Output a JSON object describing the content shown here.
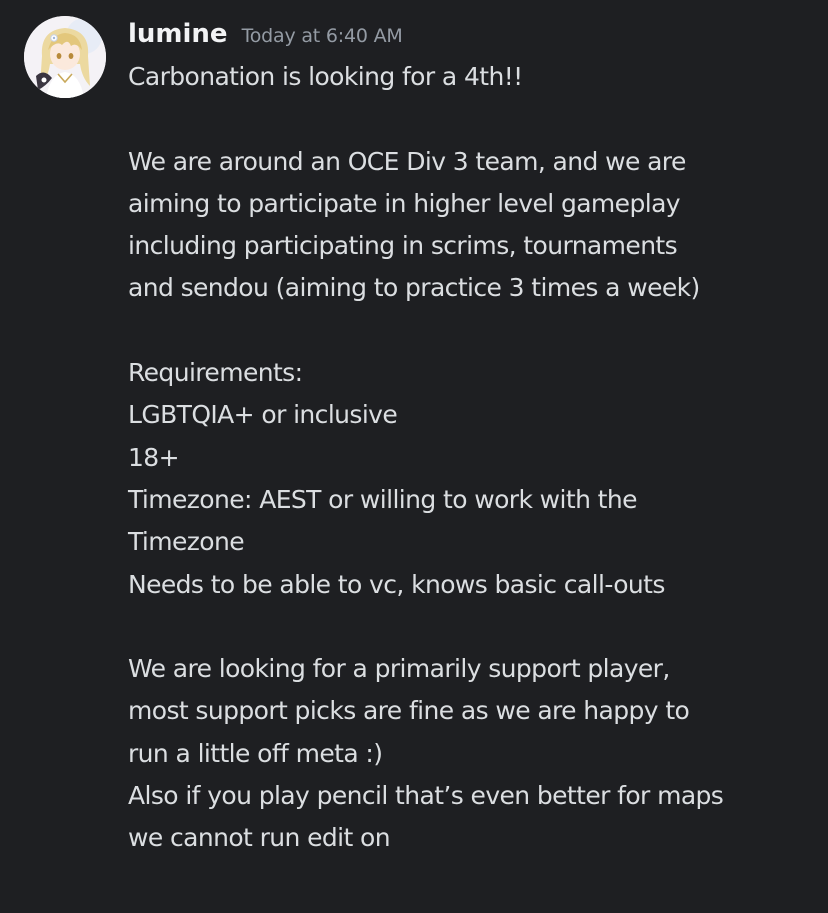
{
  "message": {
    "author": {
      "username": "lumine",
      "timestamp": "Today at 6:40 AM",
      "avatar_icon": "user-avatar-anime-character"
    },
    "lines": [
      "Carbonation is looking for a 4th!!",
      "",
      "We are around an OCE Div 3 team, and we are",
      "aiming to participate in higher level gameplay",
      "including participating in scrims, tournaments",
      "and sendou (aiming to practice 3 times a week)",
      "",
      "Requirements:",
      "LGBTQIA+ or inclusive",
      "18+",
      "Timezone: AEST or willing to work with the",
      "Timezone",
      "Needs to be able to vc, knows basic call-outs",
      "",
      "We are looking for a primarily support player,",
      "most support picks are fine as we are happy to",
      "run a little off meta :)",
      "Also if you play pencil that’s even better for maps",
      "we cannot run edit on"
    ]
  },
  "colors": {
    "background": "#1e1f22",
    "username": "#f2f3f5",
    "timestamp": "#949ba4",
    "text": "#dbdee1"
  }
}
